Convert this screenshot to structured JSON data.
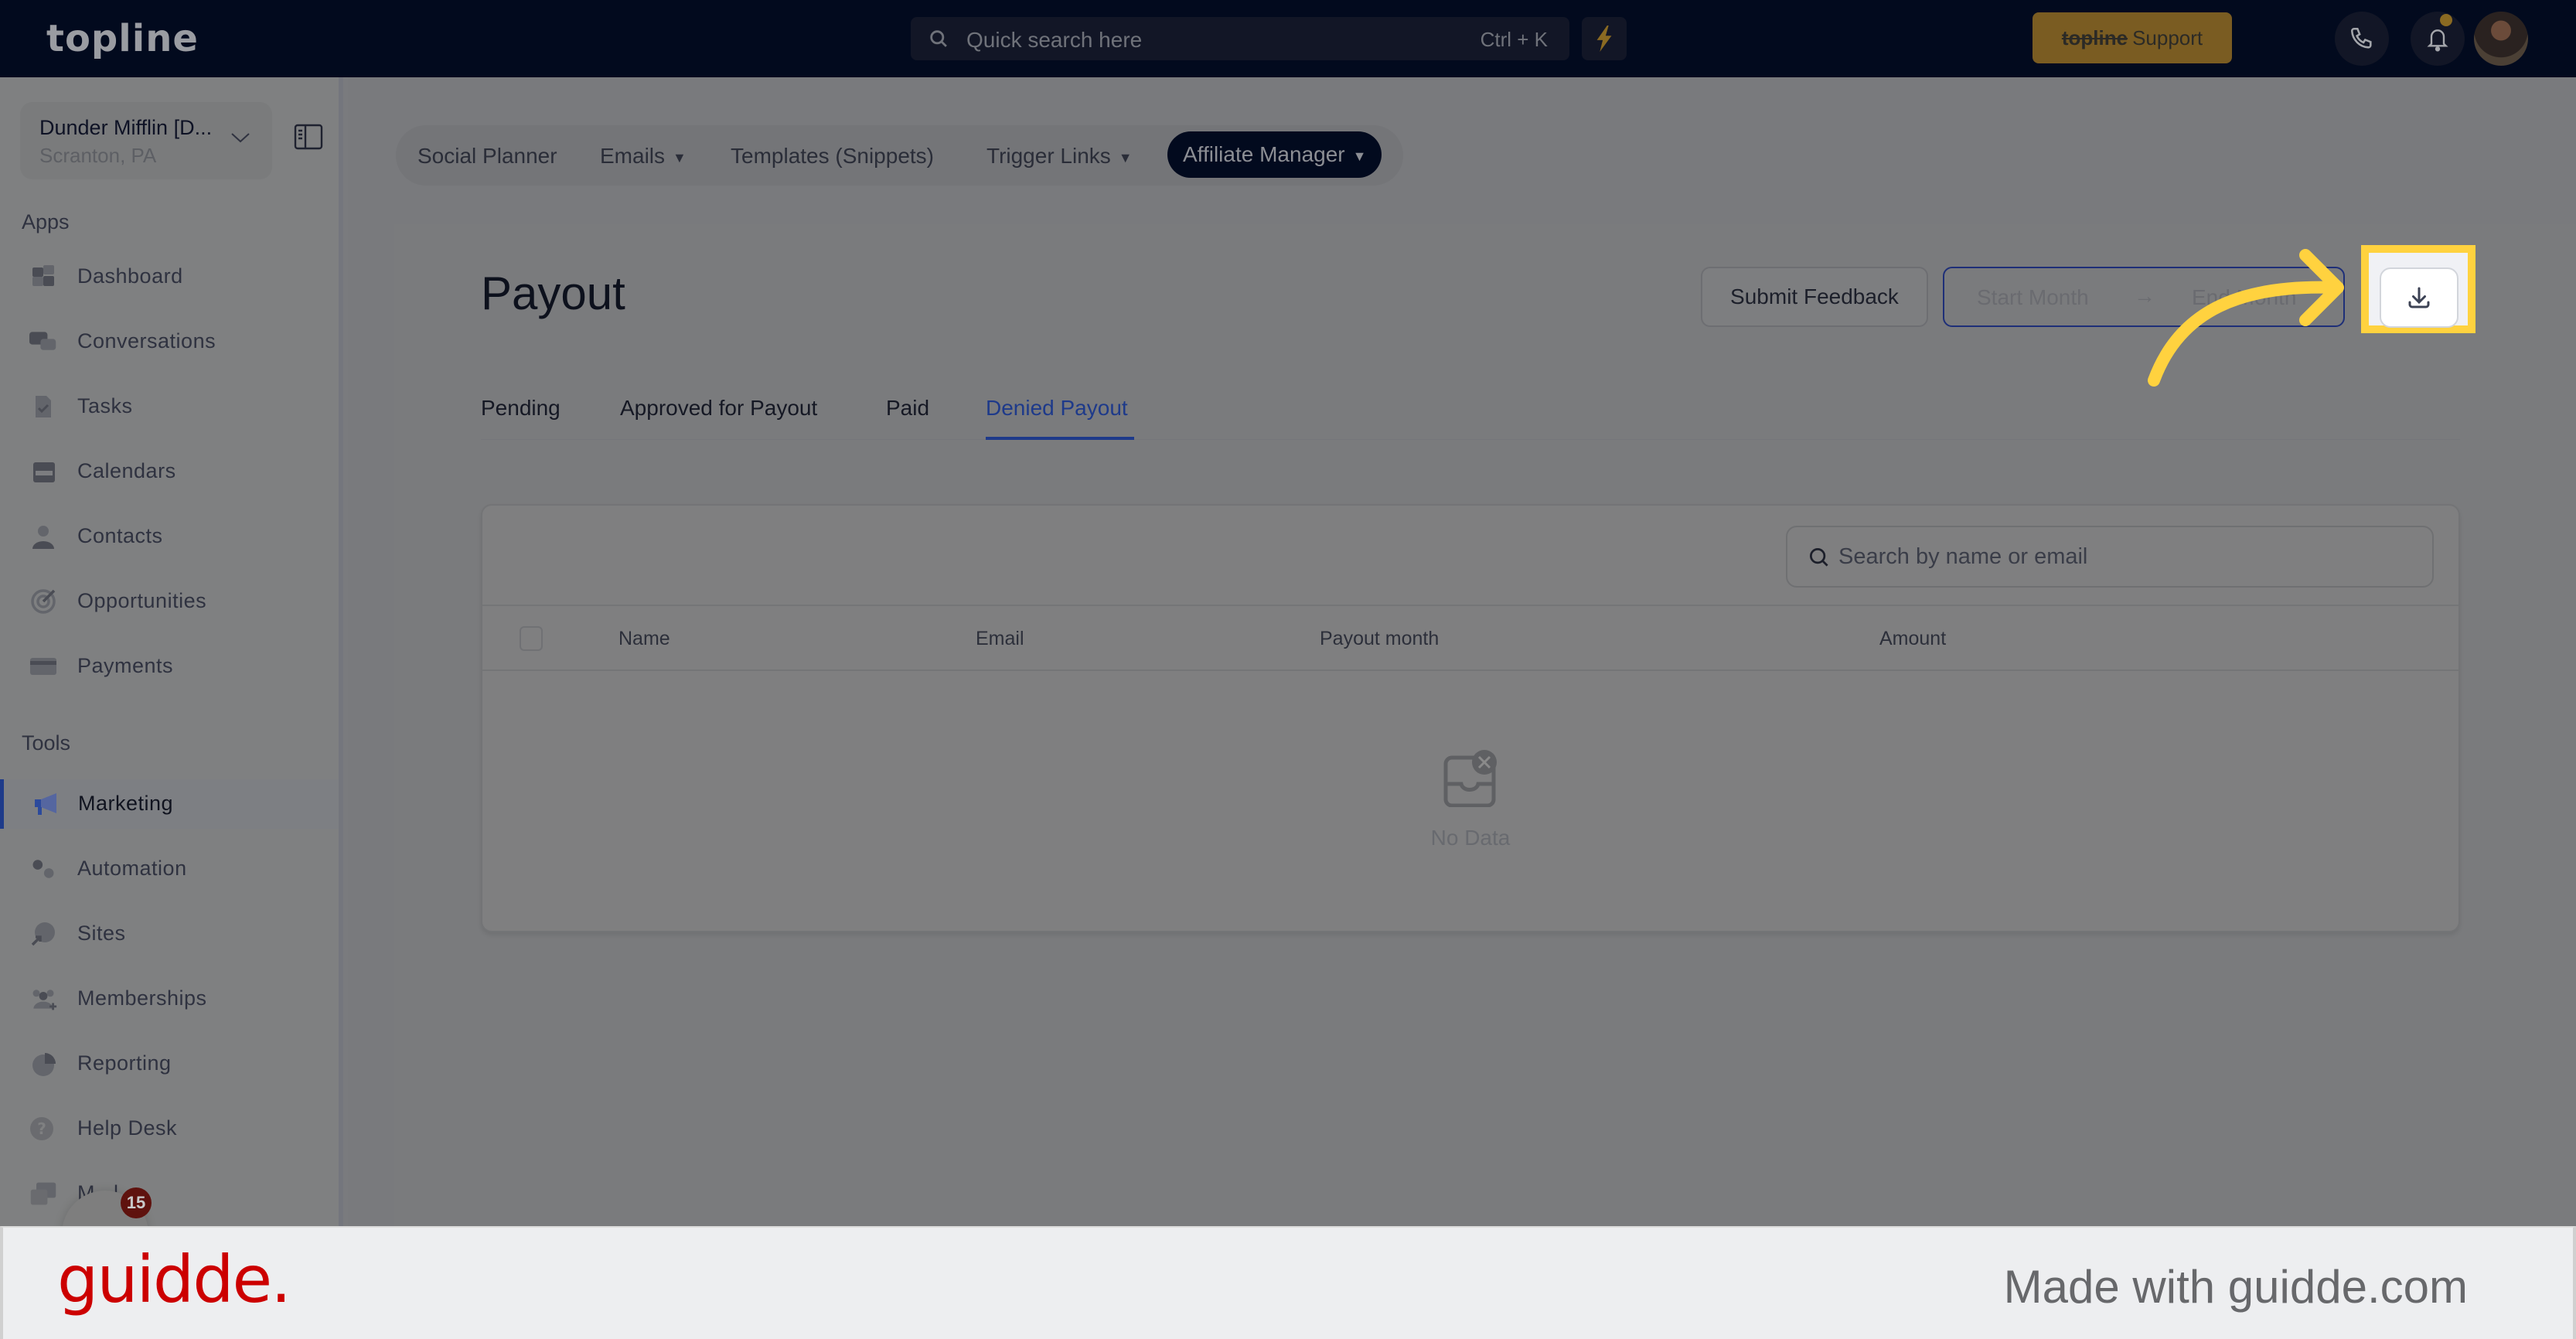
{
  "topbar": {
    "logo": "topline",
    "search_placeholder": "Quick search here",
    "search_shortcut": "Ctrl + K",
    "support_brand": "topline",
    "support_label": "Support"
  },
  "sidebar": {
    "account_name": "Dunder Mifflin [D...",
    "account_location": "Scranton, PA",
    "apps_label": "Apps",
    "tools_label": "Tools",
    "apps": [
      {
        "label": "Dashboard",
        "icon": "dashboard-icon"
      },
      {
        "label": "Conversations",
        "icon": "chat-bubbles-icon"
      },
      {
        "label": "Tasks",
        "icon": "task-check-icon"
      },
      {
        "label": "Calendars",
        "icon": "calendar-icon"
      },
      {
        "label": "Contacts",
        "icon": "user-icon"
      },
      {
        "label": "Opportunities",
        "icon": "target-icon"
      },
      {
        "label": "Payments",
        "icon": "credit-card-icon"
      }
    ],
    "tools": [
      {
        "label": "Marketing",
        "icon": "megaphone-icon",
        "active": true
      },
      {
        "label": "Automation",
        "icon": "gears-icon"
      },
      {
        "label": "Sites",
        "icon": "globe-cursor-icon"
      },
      {
        "label": "Memberships",
        "icon": "users-plus-icon"
      },
      {
        "label": "Reporting",
        "icon": "pie-chart-icon"
      },
      {
        "label": "Help Desk",
        "icon": "question-icon"
      },
      {
        "label": "M...l",
        "icon": "mail-icon"
      }
    ],
    "chat_badge_count": "15"
  },
  "subnav": {
    "items": [
      {
        "label": "Social Planner",
        "dropdown": false
      },
      {
        "label": "Emails",
        "dropdown": true
      },
      {
        "label": "Templates (Snippets)",
        "dropdown": false
      },
      {
        "label": "Trigger Links",
        "dropdown": true
      },
      {
        "label": "Affiliate Manager",
        "dropdown": true,
        "active": true
      }
    ]
  },
  "page": {
    "title": "Payout",
    "submit_feedback": "Submit Feedback",
    "start_month_placeholder": "Start Month",
    "end_month_placeholder": "End Month",
    "range_arrow": "→",
    "tabs": [
      {
        "label": "Pending"
      },
      {
        "label": "Approved for Payout"
      },
      {
        "label": "Paid"
      },
      {
        "label": "Denied Payout",
        "active": true
      }
    ],
    "table": {
      "search_placeholder": "Search by name or email",
      "columns": [
        "Name",
        "Email",
        "Payout month",
        "Amount"
      ],
      "rows": [],
      "empty_text": "No Data"
    }
  },
  "annotation": {
    "highlight_color": "#ffd23f",
    "target": "download-button"
  },
  "footer": {
    "brand": "guidde.",
    "made_with": "Made with guidde.com",
    "brand_color": "#cc0000"
  }
}
